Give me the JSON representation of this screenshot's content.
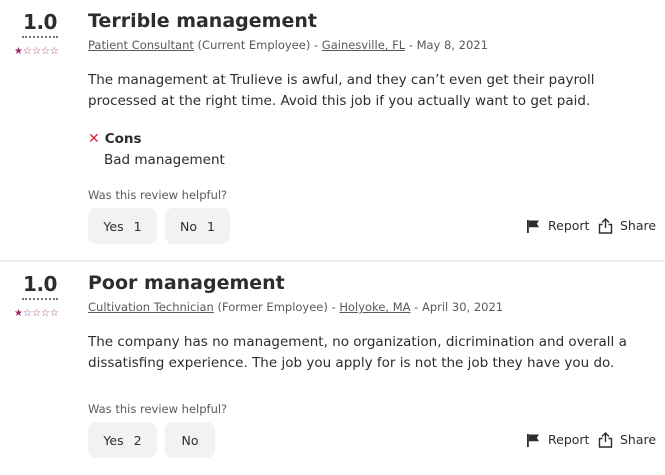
{
  "reviews": [
    {
      "rating": "1.0",
      "stars": {
        "filled": 1,
        "total": 5
      },
      "title": "Terrible management",
      "job_title": "Patient Consultant",
      "employment_status": " (Current Employee) - ",
      "location": "Gainesville, FL",
      "date": " - May 8, 2021",
      "body": "The management at Trulieve is awful, and they can’t even get their payroll processed at the right time. Avoid this job if you actually want to get paid.",
      "cons_label": "Cons",
      "cons_text": "Bad management",
      "helpful_question": "Was this review helpful?",
      "yes_label": "Yes",
      "yes_count": "1",
      "no_label": "No",
      "no_count": "1",
      "report_label": "Report",
      "share_label": "Share"
    },
    {
      "rating": "1.0",
      "stars": {
        "filled": 1,
        "total": 5
      },
      "title": "Poor management",
      "job_title": "Cultivation Technician",
      "employment_status": " (Former Employee) - ",
      "location": "Holyoke, MA",
      "date": " - April 30, 2021",
      "body": "The company has no management, no organization, dicrimination and overall a dissatisfing experience. The job you apply for is not the job they have you do.",
      "helpful_question": "Was this review helpful?",
      "yes_label": "Yes",
      "yes_count": "2",
      "no_label": "No",
      "report_label": "Report",
      "share_label": "Share"
    }
  ],
  "colors": {
    "star": "#9d2b6b",
    "cons_icon": "#d9283d",
    "button_bg": "#f3f2f1"
  },
  "icons": {
    "star_filled": "star-filled-icon",
    "star_empty": "star-outline-icon",
    "cons": "x-icon",
    "report": "flag-icon",
    "share": "share-icon"
  }
}
